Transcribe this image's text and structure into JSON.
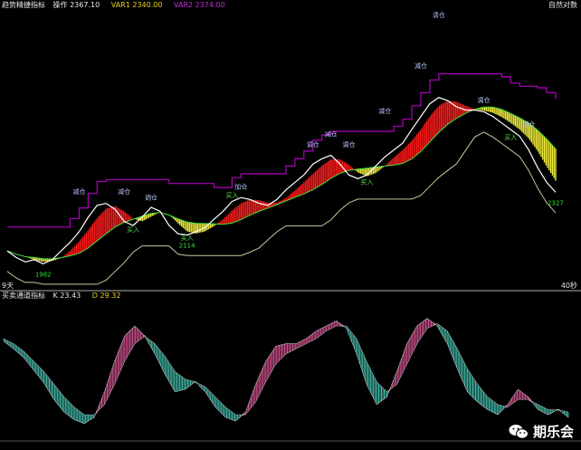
{
  "top_panel": {
    "indicator_name": "趋势精捷指标",
    "op_label": "操作",
    "op_value": "2367.10",
    "var1_label": "VAR1",
    "var1_value": "2340.00",
    "var2_label": "VAR2",
    "var2_value": "2374.00",
    "right_label": "自然对数",
    "left_bottom_label": "9天",
    "right_bottom_label": "40秒"
  },
  "bottom_panel": {
    "indicator_name": "买卖通道指标",
    "k_label": "K",
    "k_value": "23.43",
    "d_label": "D",
    "d_value": "29.32"
  },
  "watermark": "期乐会",
  "colors": {
    "bull_band": "#ff1a1a",
    "bear_band": "#f2ee3a",
    "price": "#ffffff",
    "channel_upper": "#b000c0",
    "channel_lower": "#c8c89a",
    "fast_line": "#40e040",
    "osc_up": "#d0508c",
    "osc_down": "#3fb8a8",
    "divider": "#b0b0b0"
  },
  "chart_data": [
    {
      "type": "line",
      "panel": "price",
      "y_scale": "log",
      "series": [
        {
          "values": [
            2040,
            2010,
            1990,
            2000,
            1982,
            2000,
            2040,
            2080,
            2130,
            2200,
            2260,
            2270,
            2240,
            2180,
            2160,
            2200,
            2250,
            2230,
            2160,
            2120,
            2114,
            2130,
            2150,
            2190,
            2230,
            2280,
            2300,
            2290,
            2270,
            2260,
            2290,
            2340,
            2380,
            2420,
            2480,
            2510,
            2530,
            2480,
            2420,
            2400,
            2420,
            2470,
            2520,
            2560,
            2600,
            2680,
            2760,
            2840,
            2880,
            2860,
            2820,
            2800,
            2800,
            2790,
            2760,
            2720,
            2680,
            2640,
            2560,
            2460,
            2380,
            2327
          ]
        }
      ],
      "annotations": [
        {
          "text": "减仓",
          "x": 8,
          "y": 2320
        },
        {
          "text": "减仓",
          "x": 13,
          "y": 2320
        },
        {
          "text": "调仓",
          "x": 16,
          "y": 2290
        },
        {
          "text": "加仓",
          "x": 26,
          "y": 2345
        },
        {
          "text": "调仓",
          "x": 34,
          "y": 2580
        },
        {
          "text": "减仓",
          "x": 36,
          "y": 2640
        },
        {
          "text": "调仓",
          "x": 38,
          "y": 2580
        },
        {
          "text": "减仓",
          "x": 42,
          "y": 2780
        },
        {
          "text": "减仓",
          "x": 46,
          "y": 3080
        },
        {
          "text": "清仓",
          "x": 48,
          "y": 3450
        },
        {
          "text": "调仓",
          "x": 53,
          "y": 2850
        },
        {
          "text": "调仓",
          "x": 58,
          "y": 2700
        },
        {
          "text": "买入",
          "x": 14,
          "y": 2130
        },
        {
          "text": "买入",
          "x": 20,
          "y": 2090
        },
        {
          "text": "买入",
          "x": 25,
          "y": 2300
        },
        {
          "text": "买入",
          "x": 40,
          "y": 2370
        },
        {
          "text": "买入",
          "x": 56,
          "y": 2620
        }
      ],
      "value_labels": [
        "1982",
        "2114",
        "2327"
      ]
    },
    {
      "type": "line",
      "panel": "oscillator",
      "series": [
        {
          "name": "K",
          "values": [
            68,
            62,
            55,
            45,
            35,
            22,
            12,
            6,
            3,
            8,
            28,
            52,
            72,
            80,
            72,
            58,
            42,
            28,
            30,
            36,
            28,
            16,
            8,
            5,
            12,
            34,
            52,
            64,
            66,
            66,
            70,
            76,
            80,
            84,
            78,
            58,
            34,
            18,
            24,
            44,
            66,
            80,
            86,
            80,
            66,
            46,
            28,
            20,
            14,
            10,
            18,
            30,
            24,
            14,
            10,
            14,
            8
          ]
        },
        {
          "name": "D",
          "values": [
            70,
            66,
            60,
            52,
            44,
            34,
            24,
            16,
            10,
            10,
            18,
            34,
            52,
            66,
            72,
            66,
            56,
            44,
            38,
            36,
            32,
            24,
            16,
            10,
            10,
            20,
            36,
            50,
            58,
            62,
            66,
            70,
            76,
            80,
            80,
            70,
            52,
            36,
            28,
            34,
            50,
            66,
            78,
            82,
            76,
            62,
            46,
            34,
            24,
            18,
            16,
            22,
            22,
            18,
            14,
            14,
            12
          ]
        }
      ]
    }
  ]
}
